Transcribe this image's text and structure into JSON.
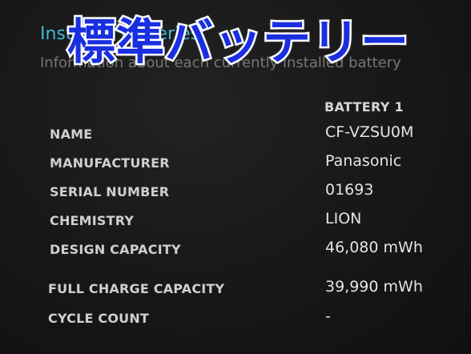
{
  "overlay": {
    "caption": "標準バッテリー"
  },
  "section": {
    "title": "Installed batteries",
    "subtitle": "Information about each currently installed battery"
  },
  "battery_table": {
    "column_header": "BATTERY 1",
    "rows": [
      {
        "label": "NAME",
        "value": "CF-VZSU0M"
      },
      {
        "label": "MANUFACTURER",
        "value": "Panasonic"
      },
      {
        "label": "SERIAL NUMBER",
        "value": "01693"
      },
      {
        "label": "CHEMISTRY",
        "value": "LION"
      },
      {
        "label": "DESIGN CAPACITY",
        "value": "46,080 mWh"
      },
      {
        "label": "FULL CHARGE CAPACITY",
        "value": "39,990 mWh"
      },
      {
        "label": "CYCLE COUNT",
        "value": "-"
      }
    ]
  },
  "colors": {
    "background": "#151515",
    "title_accent": "#3fb8d8",
    "overlay_fill": "#1a2fe0",
    "overlay_outline": "#ffffff"
  }
}
